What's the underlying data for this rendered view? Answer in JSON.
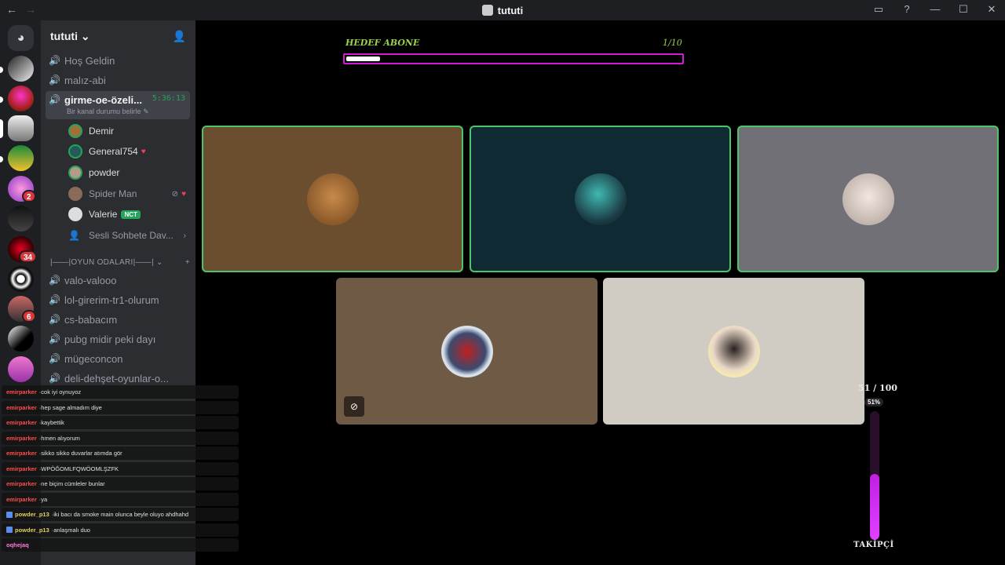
{
  "window": {
    "title": "tututi",
    "back_icon": "arrow-left-icon",
    "forward_icon": "arrow-right-icon"
  },
  "window_controls": [
    "inbox-icon",
    "help-icon",
    "minimize-icon",
    "maximize-icon",
    "close-icon"
  ],
  "server": {
    "name": "tututi"
  },
  "servers": [
    {
      "badge": ""
    },
    {
      "badge": ""
    },
    {
      "badge": ""
    },
    {
      "badge": ""
    },
    {
      "badge": "2"
    },
    {
      "badge": ""
    },
    {
      "badge": "34"
    },
    {
      "badge": ""
    },
    {
      "badge": "6"
    },
    {
      "badge": ""
    },
    {
      "badge": ""
    }
  ],
  "channels_top": [
    {
      "name": "Hoş Geldin"
    },
    {
      "name": "malız-abi"
    }
  ],
  "active_channel": {
    "name": "girme-oe-özeli...",
    "timer": "5:36:13",
    "status": "Bir kanal durumu belirle"
  },
  "voice_users": [
    {
      "name": "Demir",
      "extra": "",
      "tag": ""
    },
    {
      "name": "General754",
      "extra": "",
      "tag": ""
    },
    {
      "name": "powder",
      "extra": "",
      "tag": ""
    },
    {
      "name": "Spider Man",
      "extra": "",
      "tag": ""
    },
    {
      "name": "Valerie",
      "extra": "",
      "tag": "NCT"
    }
  ],
  "more_link": {
    "label": "Sesli Sohbete Dav..."
  },
  "category": {
    "label": "|——|OYUN ODALARI|——|"
  },
  "game_channels": [
    {
      "name": "valo-valooo"
    },
    {
      "name": "lol-girerim-tr1-olurum"
    },
    {
      "name": "cs-babacım"
    },
    {
      "name": "pubg midir peki dayı"
    },
    {
      "name": "mügeconcon"
    },
    {
      "name": "deli-dehşet-oyunlar-o..."
    }
  ],
  "goal": {
    "label": "HEDEF ABONE",
    "count": "1/10",
    "progress": 0.1
  },
  "followers": {
    "value": "51 / 100",
    "percent": "51%",
    "progress": 0.51,
    "label": "TAKİPÇİ"
  },
  "chat": [
    {
      "user": "emirparker",
      "text": "cok iyi oynuyoz",
      "color": "#ff4d4d",
      "badge": false
    },
    {
      "user": "emirparker",
      "text": "hep sage almadım diye",
      "color": "#ff4d4d",
      "badge": false
    },
    {
      "user": "emirparker",
      "text": "kaybettik",
      "color": "#ff4d4d",
      "badge": false
    },
    {
      "user": "emirparker",
      "text": "hmen alıyorum",
      "color": "#ff4d4d",
      "badge": false
    },
    {
      "user": "emirparker",
      "text": "sikko sikko duvarlar atımda gör",
      "color": "#ff4d4d",
      "badge": false
    },
    {
      "user": "emirparker",
      "text": "WPÖĞOMLFQWÖOMLŞZFK",
      "color": "#ff4d4d",
      "badge": false
    },
    {
      "user": "emirparker",
      "text": "ne biçim cümleler bunlar",
      "color": "#ff4d4d",
      "badge": false
    },
    {
      "user": "emirparker",
      "text": "ya",
      "color": "#ff4d4d",
      "badge": false
    },
    {
      "user": "powder_p13",
      "text": "iki bacı da smoke main olunca beyle oluyo ahdhahd",
      "color": "#e0d060",
      "badge": true
    },
    {
      "user": "powder_p13",
      "text": "anlaşmalı duo",
      "color": "#e0d060",
      "badge": true
    },
    {
      "user": "oqhejaq",
      "text": "",
      "color": "#ff7ad9",
      "badge": false
    }
  ]
}
